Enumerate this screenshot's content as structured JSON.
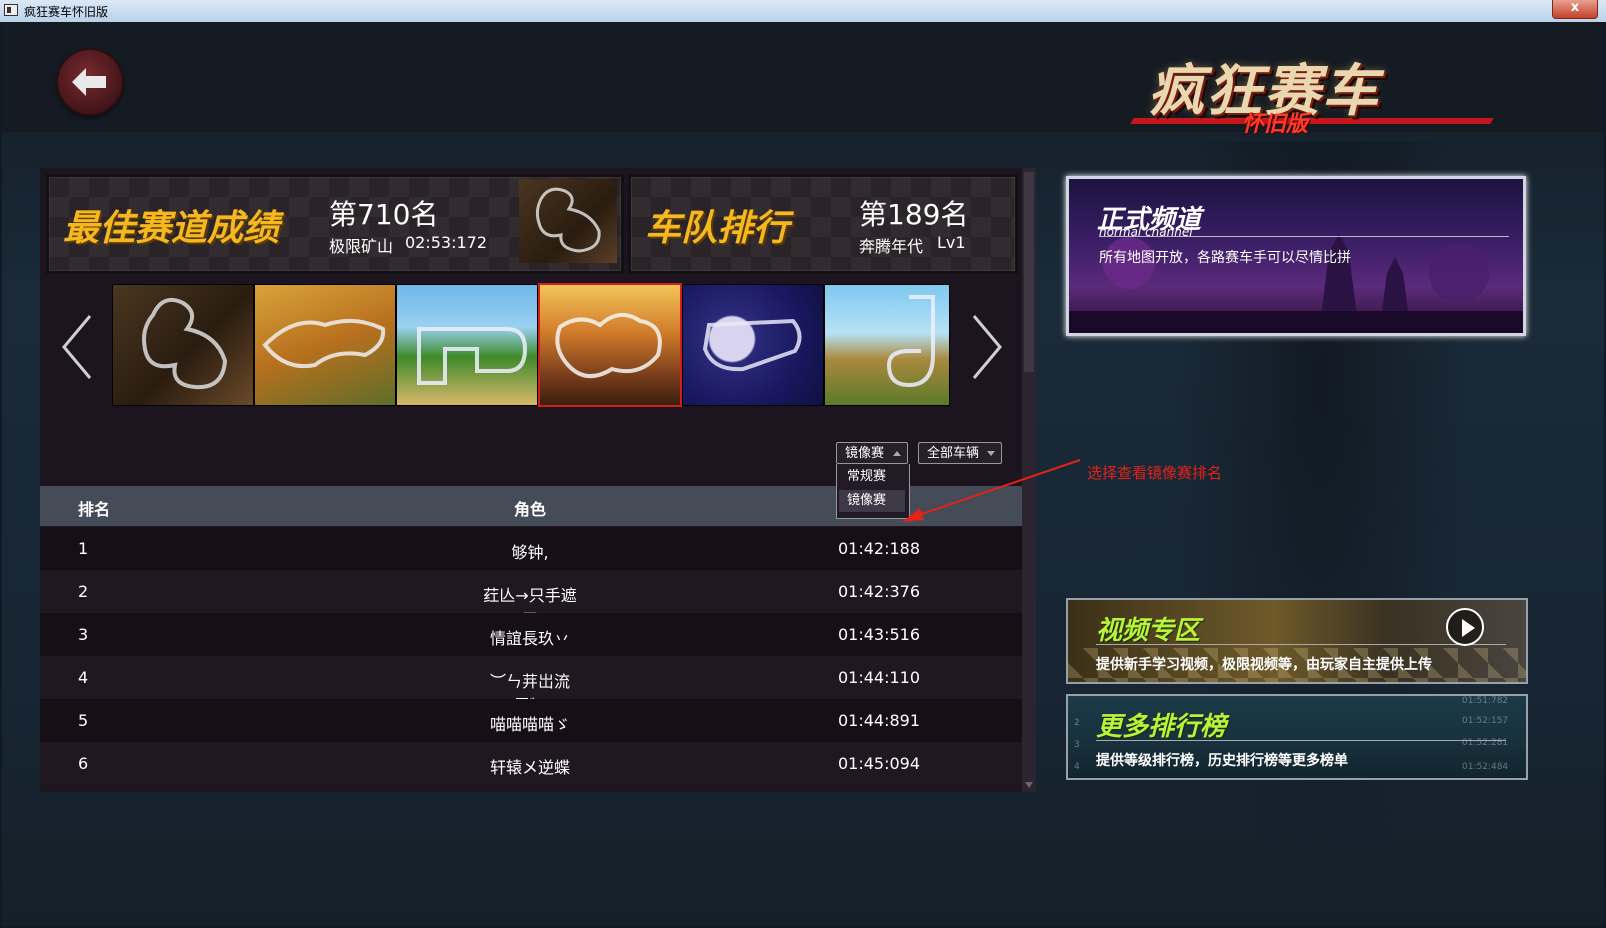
{
  "window": {
    "title": "疯狂赛车怀旧版",
    "close_label": "x"
  },
  "logo": {
    "main": "疯狂赛车",
    "sub": "怀旧版"
  },
  "best_track": {
    "title": "最佳赛道成绩",
    "rank": "第710名",
    "track": "极限矿山",
    "time": "02:53:172"
  },
  "team_rank": {
    "title": "车队排行",
    "rank": "第189名",
    "team": "奔腾年代",
    "level": "Lv1"
  },
  "tracks": {
    "count": 6,
    "selected_index": 3
  },
  "filters": {
    "mode_selected": "镜像赛",
    "mode_options": [
      "常规赛",
      "镜像赛"
    ],
    "vehicle_selected": "全部车辆"
  },
  "table": {
    "headers": [
      "排名",
      "角色",
      ""
    ],
    "rows": [
      {
        "rank": "1",
        "name": "够钟,",
        "time": "01:42:188"
      },
      {
        "rank": "2",
        "name": "荭亾→只手遮天",
        "time": "01:42:376"
      },
      {
        "rank": "3",
        "name": "情誼長玖丷",
        "time": "01:43:516"
      },
      {
        "rank": "4",
        "name": "︶ㄣ茾岀流雲゛",
        "time": "01:44:110"
      },
      {
        "rank": "5",
        "name": "喵喵喵喵ゞ",
        "time": "01:44:891"
      },
      {
        "rank": "6",
        "name": "轩辕メ逆蝶",
        "time": "01:45:094"
      }
    ]
  },
  "annotation": "选择查看镜像赛排名",
  "channels": {
    "normal": {
      "title": "正式频道",
      "subtitle": "normal channel",
      "desc": "所有地图开放，各路赛车手可以尽情比拼"
    },
    "video": {
      "title": "视频专区",
      "desc": "提供新手学习视频，极限视频等，由玩家自主提供上传"
    },
    "more_ranks": {
      "title": "更多排行榜",
      "desc": "提供等级排行榜，历史排行榜等更多榜单",
      "bg_times": [
        "01:51:782",
        "01:52:157",
        "01:52:281",
        "01:52:484"
      ],
      "bg_ranks": [
        "2",
        "3",
        "4"
      ]
    }
  },
  "colors": {
    "accent_gold": "#f5b81f",
    "selected_border": "#d0201e",
    "annotation": "#e4221a",
    "lime": "#b7f33a"
  }
}
